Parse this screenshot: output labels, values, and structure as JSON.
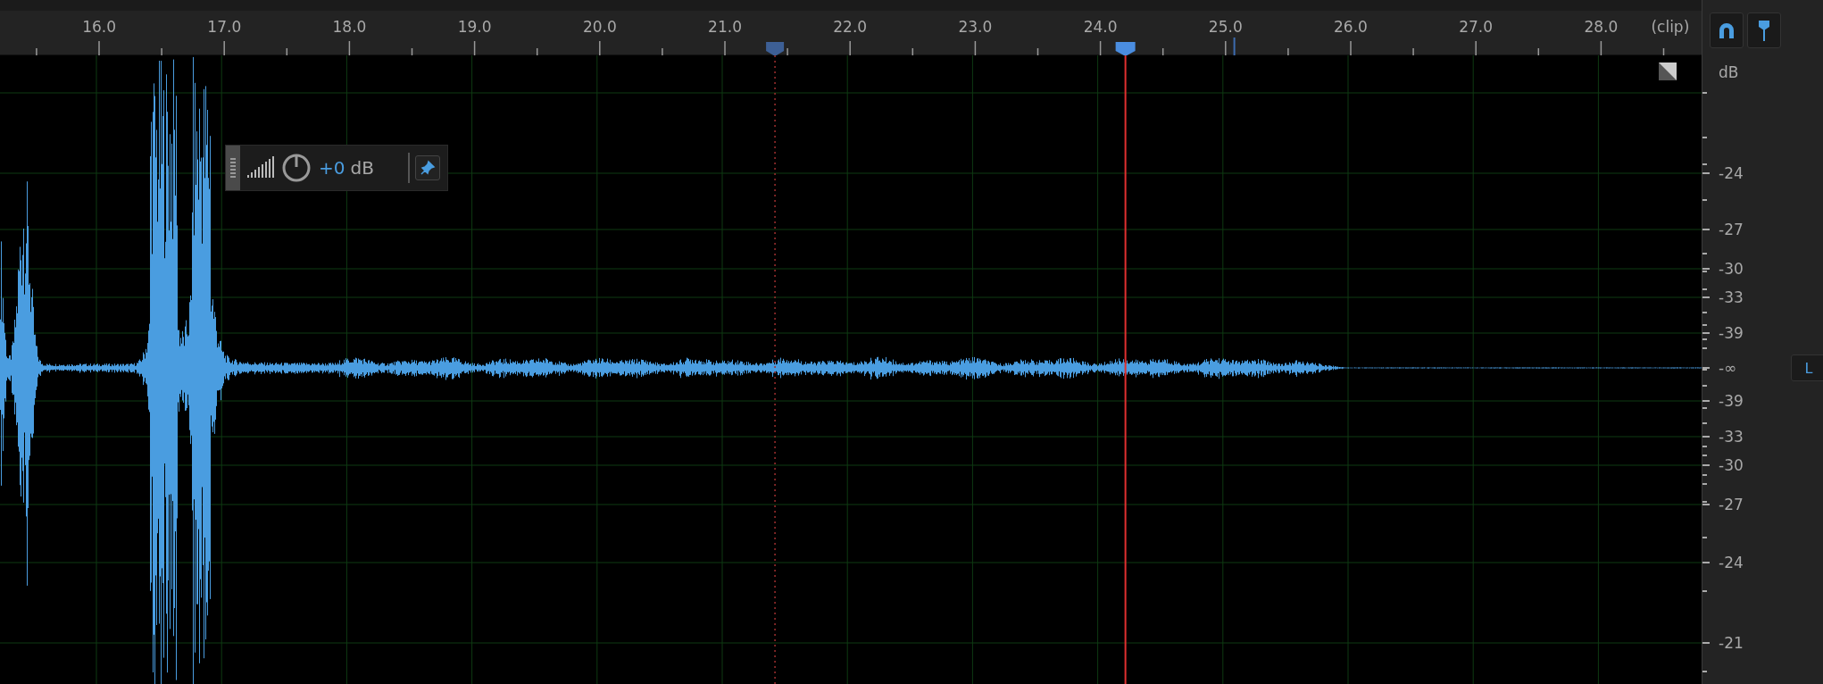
{
  "ruler": {
    "labels": [
      "16.0",
      "17.0",
      "18.0",
      "19.0",
      "20.0",
      "21.0",
      "22.0",
      "23.0",
      "24.0",
      "25.0",
      "26.0",
      "27.0",
      "28.0"
    ],
    "end_label": "(clip)"
  },
  "toolbar": [
    {
      "kind": "snap",
      "on": true
    },
    {
      "kind": "marker",
      "on": true
    }
  ],
  "hud": {
    "value": "+0",
    "unit": "dB",
    "pinned": true
  },
  "db_scale": {
    "unit": "dB",
    "labels": [
      "-24",
      "-27",
      "-30",
      "-33",
      "-39",
      "-∞",
      "-39",
      "-33",
      "-30",
      "-27",
      "-24",
      "-21"
    ]
  },
  "channel": {
    "label": "L"
  }
}
